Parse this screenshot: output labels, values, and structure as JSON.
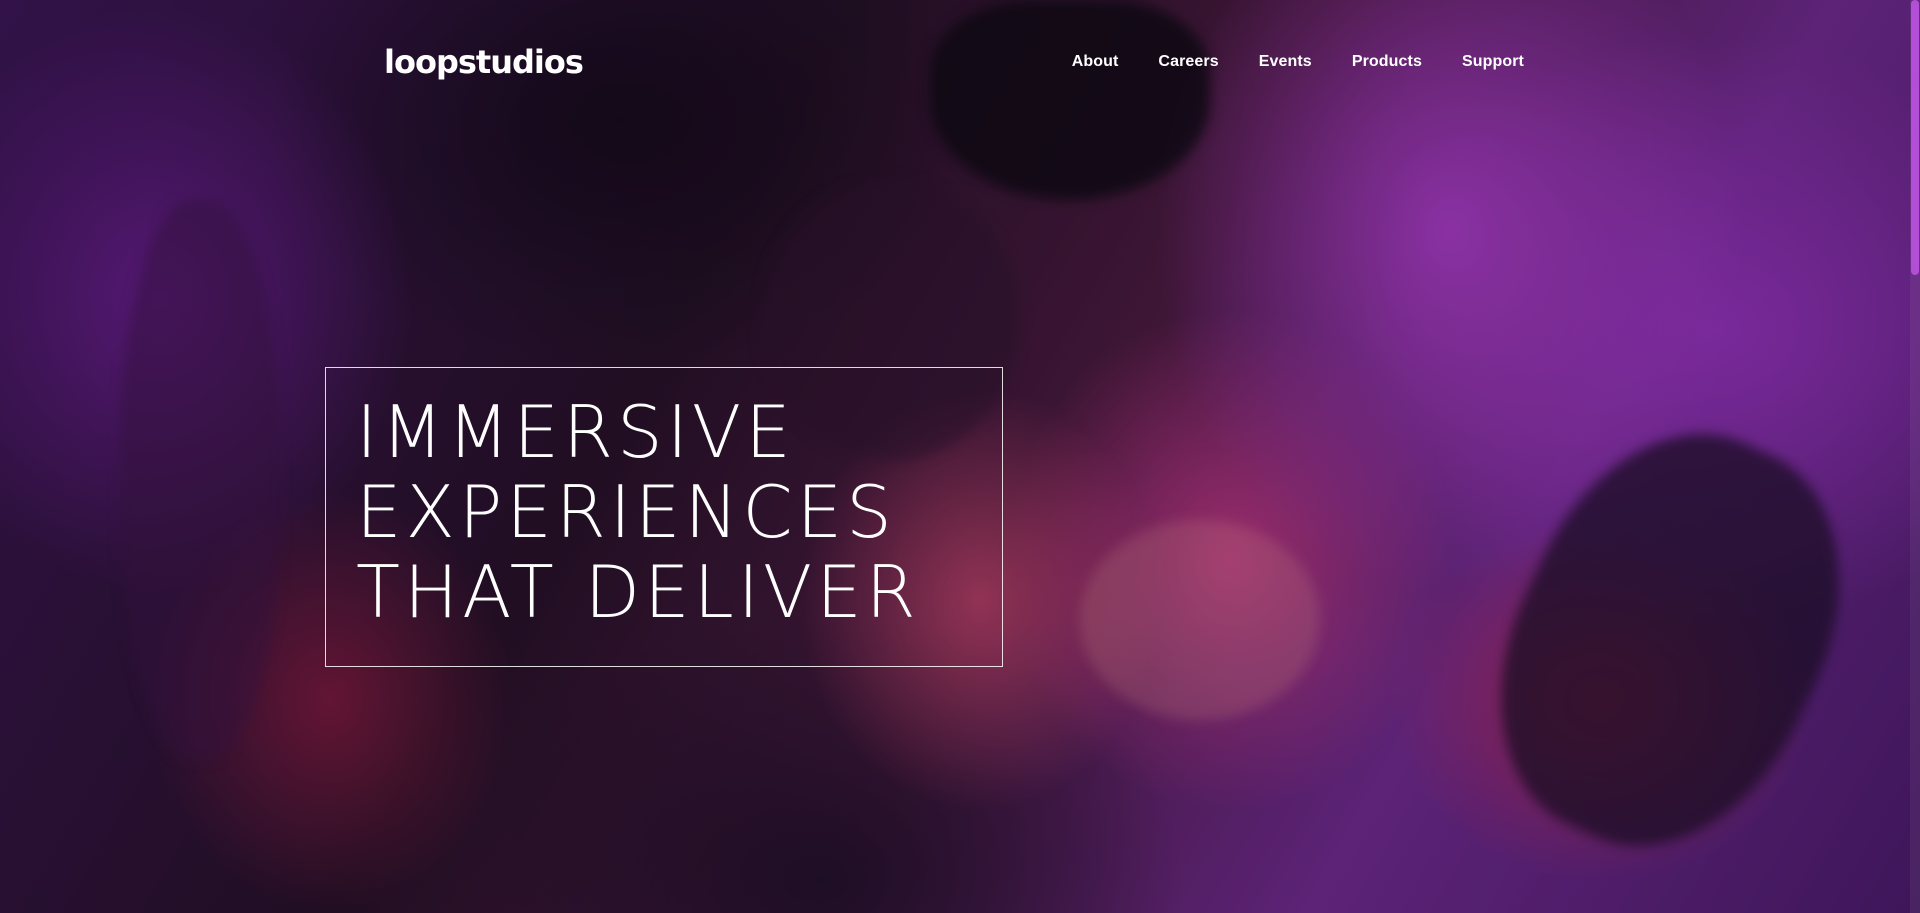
{
  "brand": {
    "logo_text": "loopstudios"
  },
  "nav": {
    "items": [
      {
        "label": "About"
      },
      {
        "label": "Careers"
      },
      {
        "label": "Events"
      },
      {
        "label": "Products"
      },
      {
        "label": "Support"
      }
    ]
  },
  "hero": {
    "title_lines": [
      "IMMERSIVE",
      "EXPERIENCES",
      "THAT DELIVER"
    ]
  },
  "colors": {
    "text": "#ffffff",
    "accent_scrollbar": "#b24fd6",
    "background_tint": "#6f2a8e"
  }
}
